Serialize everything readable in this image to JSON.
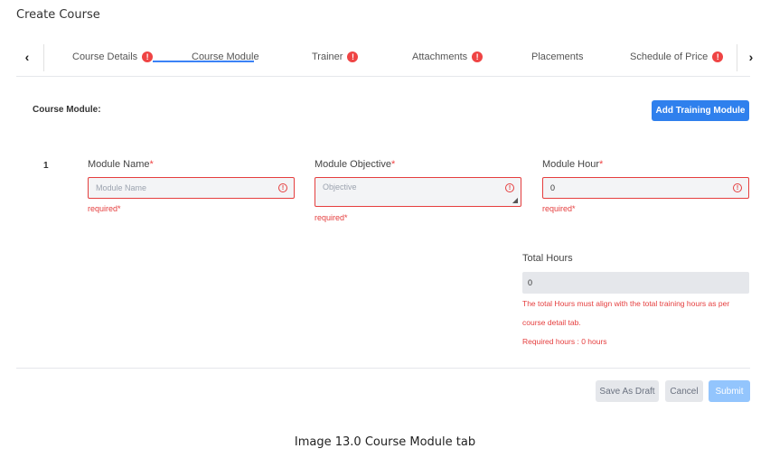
{
  "page": {
    "title": "Create Course"
  },
  "tabs": {
    "prev_icon": "chevron-left-icon",
    "next_icon": "chevron-right-icon",
    "items": [
      {
        "label": "Course Details",
        "error": true
      },
      {
        "label": "Course Module",
        "error": false,
        "active": true
      },
      {
        "label": "Trainer",
        "error": true
      },
      {
        "label": "Attachments",
        "error": true
      },
      {
        "label": "Placements",
        "error": false
      },
      {
        "label": "Schedule of Price",
        "error": true
      }
    ],
    "error_glyph": "!"
  },
  "module_section": {
    "label": "Course Module:",
    "add_button": "Add Training Module",
    "row_number": "1",
    "fields": {
      "name": {
        "label": "Module Name",
        "required_mark": "*",
        "placeholder": "Module Name",
        "value": "",
        "error": "required*"
      },
      "objective": {
        "label": "Module Objective",
        "required_mark": "*",
        "placeholder": "Objective",
        "value": "",
        "error": "required*"
      },
      "hour": {
        "label": "Module Hour",
        "required_mark": "*",
        "placeholder": "",
        "value": "0",
        "error": "required*"
      }
    },
    "error_icon_glyph": "!"
  },
  "total": {
    "label": "Total Hours",
    "value": "0",
    "warning_line1": "The total Hours must align with the total training hours as per",
    "warning_line2": "course detail tab.",
    "required_hours": "Required hours : 0 hours"
  },
  "footer": {
    "save_draft": "Save As Draft",
    "cancel": "Cancel",
    "submit": "Submit"
  },
  "caption": "Image 13.0 Course Module tab",
  "colors": {
    "accent": "#2f80ed",
    "error": "#e53e3e",
    "submit_disabled": "#93c5fd"
  }
}
